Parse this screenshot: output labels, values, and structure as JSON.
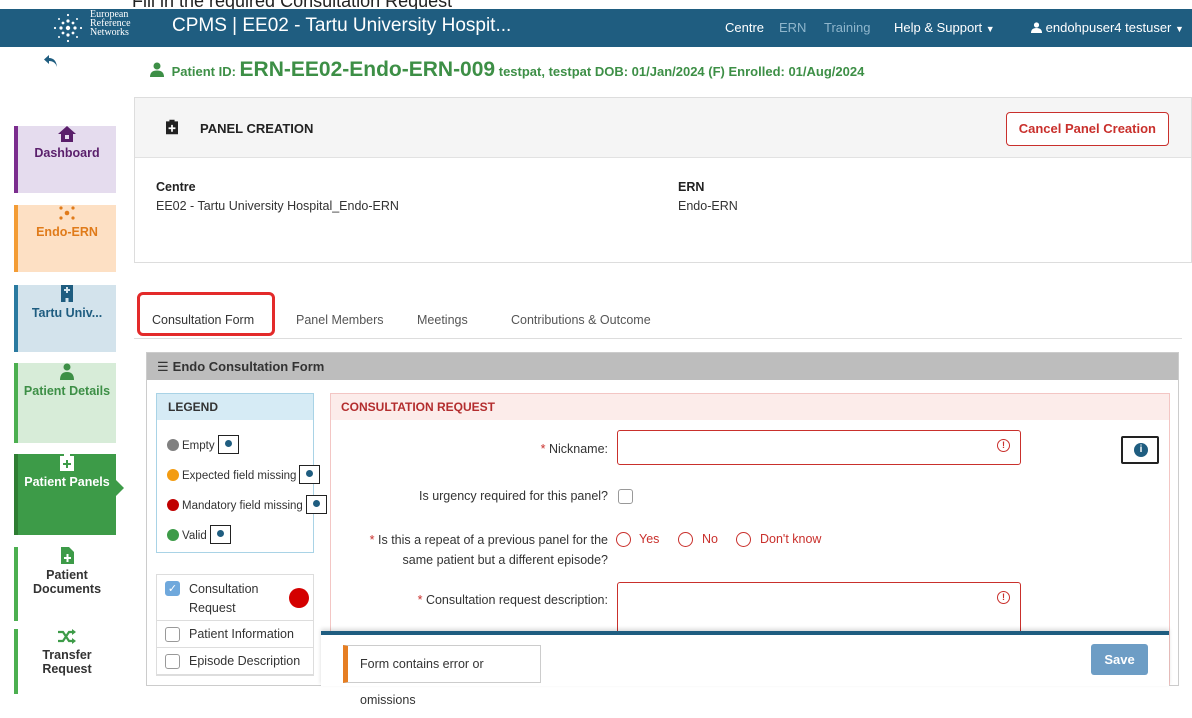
{
  "caption": "Fill in the required Consultation Request",
  "header": {
    "logo_text": [
      "European",
      "Reference",
      "Networks"
    ],
    "app_title": "CPMS | EE02 - Tartu University Hospit...",
    "nav": {
      "centre": "Centre",
      "ern": "ERN",
      "training": "Training",
      "help": "Help & Support",
      "user": "endohpuser4 testuser"
    }
  },
  "patient": {
    "label": "Patient ID:",
    "id": "ERN-EE02-Endo-ERN-009",
    "name": "testpat, testpat",
    "dob": "DOB: 01/Jan/2024 (F)",
    "enrolled": "Enrolled: 01/Aug/2024"
  },
  "sidebar": {
    "items": [
      {
        "label": "Dashboard",
        "icon": "home-icon",
        "bg": "#e5dcee",
        "bar": "#7b2d8e",
        "color": "#5a1f6b"
      },
      {
        "label": "Endo-ERN",
        "icon": "network-icon",
        "bg": "#fde0c4",
        "bar": "#f39c35",
        "color": "#e07b1a"
      },
      {
        "label": "Tartu Univ...",
        "icon": "building-icon",
        "bg": "#d3e3ec",
        "bar": "#2a7aa0",
        "color": "#1f5d80"
      },
      {
        "label": "Patient Details",
        "icon": "patient-icon",
        "bg": "#d7ecd8",
        "bar": "#4caf50",
        "color": "#3d8f46"
      },
      {
        "label": "Patient Panels",
        "icon": "clipboard-icon",
        "bg": "#3d9b48",
        "bar": "#2e7d32",
        "color": "#ffffff"
      },
      {
        "label": "Patient Documents",
        "icon": "document-icon",
        "bg": "#ffffff",
        "bar": "#4caf50",
        "color": "#333333"
      },
      {
        "label": "Transfer Request",
        "icon": "transfer-icon",
        "bg": "#ffffff",
        "bar": "#4caf50",
        "color": "#333333"
      }
    ]
  },
  "panel": {
    "title": "PANEL CREATION",
    "cancel_label": "Cancel Panel Creation",
    "centre_label": "Centre",
    "centre_value": "EE02 - Tartu University Hospital_Endo-ERN",
    "ern_label": "ERN",
    "ern_value": "Endo-ERN"
  },
  "tabs": [
    "Consultation Form",
    "Panel Members",
    "Meetings",
    "Contributions & Outcome"
  ],
  "form": {
    "title": "Endo Consultation Form",
    "legend": {
      "title": "LEGEND",
      "items": [
        {
          "label": "Empty",
          "color": "#808080"
        },
        {
          "label": "Expected field missing",
          "color": "#f39c12"
        },
        {
          "label": "Mandatory field missing",
          "color": "#c00000"
        },
        {
          "label": "Valid",
          "color": "#3d9b48"
        }
      ]
    },
    "sections": [
      {
        "label": "Consultation Request",
        "checked": true,
        "status": "#d40000"
      },
      {
        "label": "Patient Information",
        "checked": false
      },
      {
        "label": "Episode Description",
        "checked": false
      }
    ],
    "request": {
      "title": "CONSULTATION REQUEST",
      "nickname_label": "Nickname:",
      "nickname_value": "",
      "urgency_label": "Is urgency required for this panel?",
      "repeat_label_1": "Is this a repeat of a previous panel for the",
      "repeat_label_2": "same patient but a different episode?",
      "options": [
        "Yes",
        "No",
        "Don't know"
      ],
      "description_label": "Consultation request description:",
      "description_value": ""
    }
  },
  "footer": {
    "error_text": "Form contains error or omissions",
    "save_label": "Save"
  }
}
